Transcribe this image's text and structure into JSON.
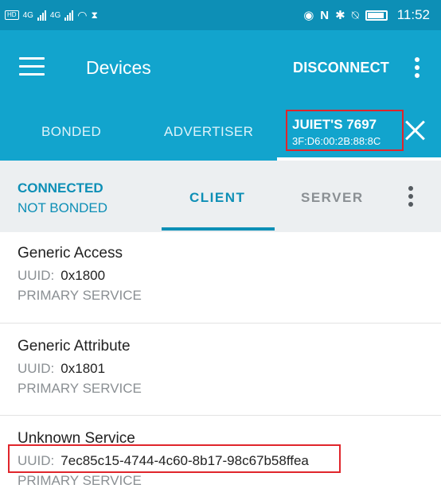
{
  "status_bar": {
    "left_items": [
      "HD",
      "4G",
      "4G"
    ],
    "time": "11:52",
    "icons": [
      "eye-icon",
      "nfc-icon",
      "bluetooth-icon",
      "mute-icon",
      "battery-icon"
    ]
  },
  "toolbar": {
    "title": "Devices",
    "disconnect_label": "DISCONNECT",
    "menu_icon": "hamburger-menu-icon",
    "overflow_icon": "more-vert-icon"
  },
  "device_tabs": {
    "items": [
      {
        "label": "BONDED"
      },
      {
        "label": "ADVERTISER"
      }
    ],
    "active_device": {
      "name": "JUIET'S 7697",
      "address": "3F:D6:00:2B:88:8C"
    },
    "close_icon": "close-icon"
  },
  "connection": {
    "state": "CONNECTED",
    "bond_state": "NOT BONDED",
    "tabs": [
      {
        "label": "CLIENT",
        "active": true
      },
      {
        "label": "SERVER",
        "active": false
      }
    ]
  },
  "services": [
    {
      "name": "Generic Access",
      "uuid_label": "UUID:",
      "uuid": "0x1800",
      "type": "PRIMARY SERVICE"
    },
    {
      "name": "Generic Attribute",
      "uuid_label": "UUID:",
      "uuid": "0x1801",
      "type": "PRIMARY SERVICE"
    },
    {
      "name": "Unknown Service",
      "uuid_label": "UUID:",
      "uuid": "7ec85c15-4744-4c60-8b17-98c67b58ffea",
      "type": "PRIMARY SERVICE"
    }
  ],
  "colors": {
    "toolbar": "#12a4cd",
    "status_bar": "#0d8fb6",
    "accent": "#0d8fb6",
    "highlight": "#e0252b"
  }
}
